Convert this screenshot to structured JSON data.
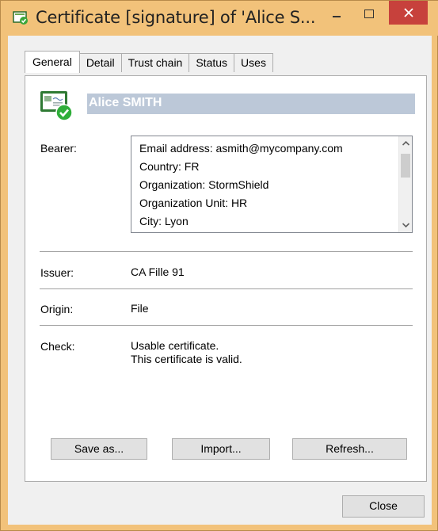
{
  "window": {
    "title": "Certificate [signature] of 'Alice S...",
    "icon": "certificate-check-icon"
  },
  "tabs": [
    {
      "label": "General",
      "active": true
    },
    {
      "label": "Detail",
      "active": false
    },
    {
      "label": "Trust chain",
      "active": false
    },
    {
      "label": "Status",
      "active": false
    },
    {
      "label": "Uses",
      "active": false
    }
  ],
  "general": {
    "subject_name": "Alice SMITH",
    "bearer": {
      "label": "Bearer:",
      "lines": [
        "Email address: asmith@mycompany.com",
        "Country: FR",
        "Organization: StormShield",
        "Organization Unit: HR",
        "City: Lyon"
      ]
    },
    "issuer": {
      "label": "Issuer:",
      "value": "CA Fille 91"
    },
    "origin": {
      "label": "Origin:",
      "value": "File"
    },
    "check": {
      "label": "Check:",
      "line1": "Usable certificate.",
      "line2": "This certificate is valid."
    }
  },
  "buttons": {
    "save_as": "Save as...",
    "import": "Import...",
    "refresh": "Refresh...",
    "close": "Close"
  },
  "colors": {
    "title_bar": "#f2c27a",
    "close_button": "#c7413c",
    "name_highlight": "#bcc8d8"
  }
}
